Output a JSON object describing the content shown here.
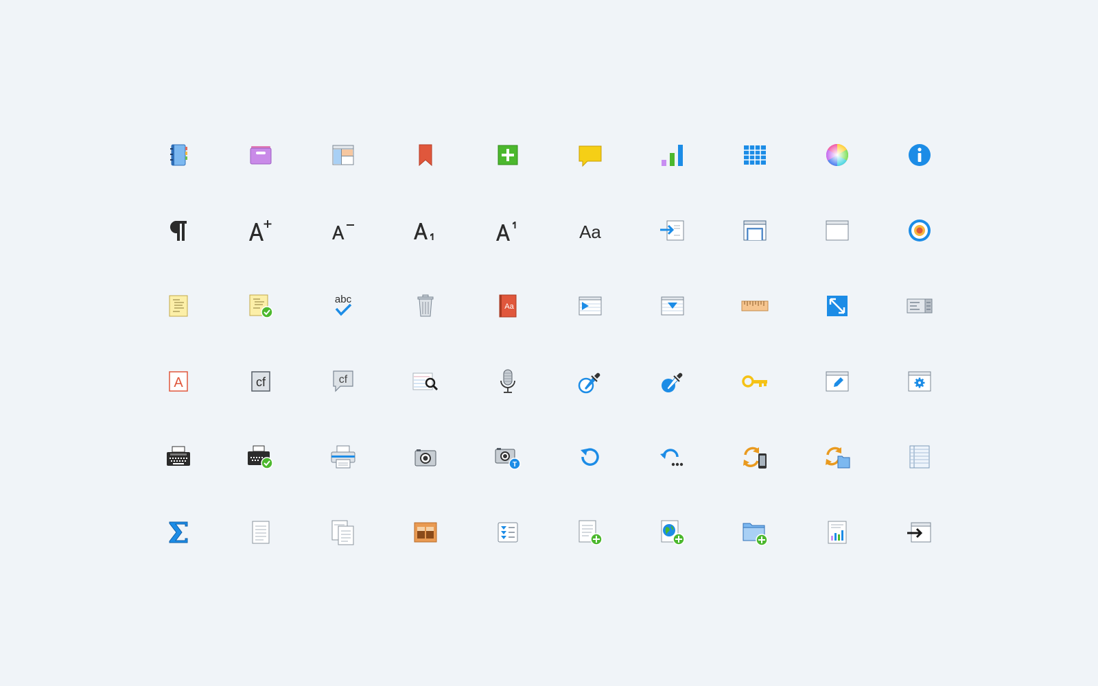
{
  "labels": {
    "dictionary": "Aa",
    "font_panel": "Aa",
    "text_color": "A",
    "conditional_format": "cf",
    "conditional_comment": "cf",
    "spelling": "abc",
    "key_text": "T"
  },
  "icons": [
    "contacts-book-icon",
    "archive-box-icon",
    "layout-icon",
    "bookmark-icon",
    "add-button-icon",
    "comment-bubble-icon",
    "bar-chart-icon",
    "table-grid-icon",
    "color-wheel-icon",
    "info-icon",
    "pilcrow-icon",
    "increase-font-icon",
    "decrease-font-icon",
    "subscript-icon",
    "superscript-icon",
    "font-panel-icon",
    "insert-icon",
    "window-frame-icon",
    "window-icon",
    "target-icon",
    "notes-icon",
    "notes-check-icon",
    "spell-check-icon",
    "trash-icon",
    "dictionary-icon",
    "play-media-icon",
    "dropdown-list-icon",
    "ruler-icon",
    "expand-icon",
    "sidebar-toggle-icon",
    "text-color-icon",
    "conditional-format-icon",
    "conditional-comment-icon",
    "find-in-text-icon",
    "microphone-icon",
    "eyedropper-fill-icon",
    "eyedropper-stroke-icon",
    "key-icon",
    "edit-window-icon",
    "settings-window-icon",
    "typewriter-icon",
    "typewriter-check-icon",
    "printer-icon",
    "camera-icon",
    "camera-text-icon",
    "refresh-icon",
    "refresh-more-icon",
    "sync-device-icon",
    "sync-folder-icon",
    "list-sheet-icon",
    "sum-icon",
    "document-icon",
    "documents-icon",
    "color-blocks-icon",
    "sort-list-icon",
    "new-document-icon",
    "new-web-page-icon",
    "new-folder-icon",
    "report-chart-icon",
    "export-icon"
  ],
  "colors": {
    "background": "#f0f4f8",
    "accent_blue": "#1c8ce6",
    "accent_green": "#4cb82e",
    "accent_orange": "#e99a1f",
    "accent_red": "#e0573c",
    "accent_yellow": "#f5cf16"
  }
}
